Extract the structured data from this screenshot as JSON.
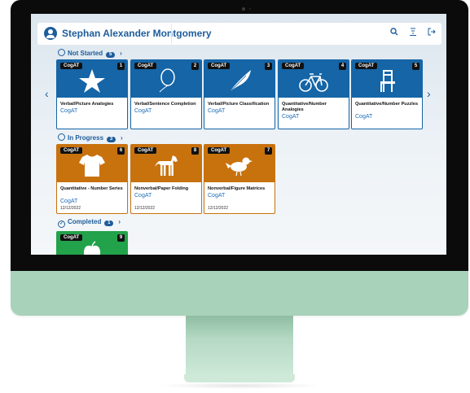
{
  "header": {
    "user_name": "Stephan Alexander Montgomery",
    "icons": [
      "search-icon",
      "sort-icon",
      "logout-icon"
    ]
  },
  "sections": {
    "not_started": {
      "label": "Not Started",
      "count": "5"
    },
    "in_progress": {
      "label": "In Progress",
      "count": "3"
    },
    "completed": {
      "label": "Completed",
      "count": "1"
    }
  },
  "cards": {
    "c1": {
      "badge": "CogAT",
      "number": "1",
      "title": "Verbal/Picture Analogies",
      "subtitle": "CogAT",
      "icon": "star-icon"
    },
    "c2": {
      "badge": "CogAT",
      "number": "2",
      "title": "Verbal/Sentence Completion",
      "subtitle": "CogAT",
      "icon": "balloon-icon"
    },
    "c3": {
      "badge": "CogAT",
      "number": "3",
      "title": "Verbal/Picture Classification",
      "subtitle": "CogAT",
      "icon": "feather-icon"
    },
    "c4": {
      "badge": "CogAT",
      "number": "4",
      "title": "Quantitative/Number Analogies",
      "subtitle": "CogAT",
      "icon": "bicycle-icon"
    },
    "c5": {
      "badge": "CogAT",
      "number": "5",
      "title": "Quantitative/Number Puzzles",
      "subtitle": "CogAT",
      "icon": "chair-icon"
    },
    "c6": {
      "badge": "CogAT",
      "number": "6",
      "title": "Quantitative - Number Series",
      "subtitle": "CogAT",
      "date": "12/12/2022",
      "icon": "shirt-icon"
    },
    "c8": {
      "badge": "CogAT",
      "number": "8",
      "title": "Nonverbal/Paper Folding",
      "subtitle": "CogAT",
      "date": "12/12/2022",
      "icon": "horse-icon"
    },
    "c7": {
      "badge": "CogAT",
      "number": "7",
      "title": "Nonverbal/Figure Matrices",
      "subtitle": "CogAT",
      "date": "12/12/2022",
      "icon": "bird-icon"
    },
    "c9": {
      "badge": "CogAT",
      "number": "9",
      "icon": "apple-icon"
    }
  },
  "colors": {
    "not_started": "#1565a7",
    "in_progress": "#c8720e",
    "completed": "#22a24a",
    "brand": "#1e5d9b",
    "device": "#a9d2bb"
  }
}
